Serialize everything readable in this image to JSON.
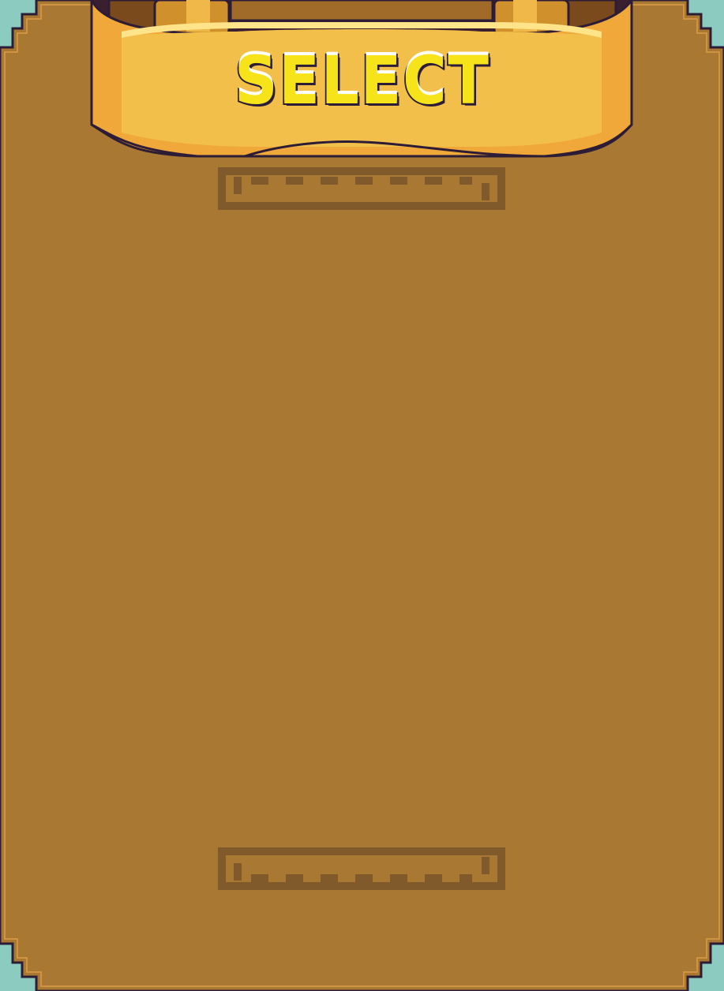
{
  "panel": {
    "title": "SELECT"
  },
  "colors": {
    "board": "#a97832",
    "board_outline": "#2c1c36",
    "board_highlight": "#d89a45",
    "corner": "#8ccbc0",
    "ribbon": "#f2c04a",
    "ribbon_shade": "#f0a83a",
    "ribbon_light": "#ffe48a",
    "rod": "#d0902c",
    "rod_dark": "#7a4a1c",
    "meander": "#805a2a",
    "title_fill": "#f6e31a",
    "title_outline": "#2c1c36"
  }
}
